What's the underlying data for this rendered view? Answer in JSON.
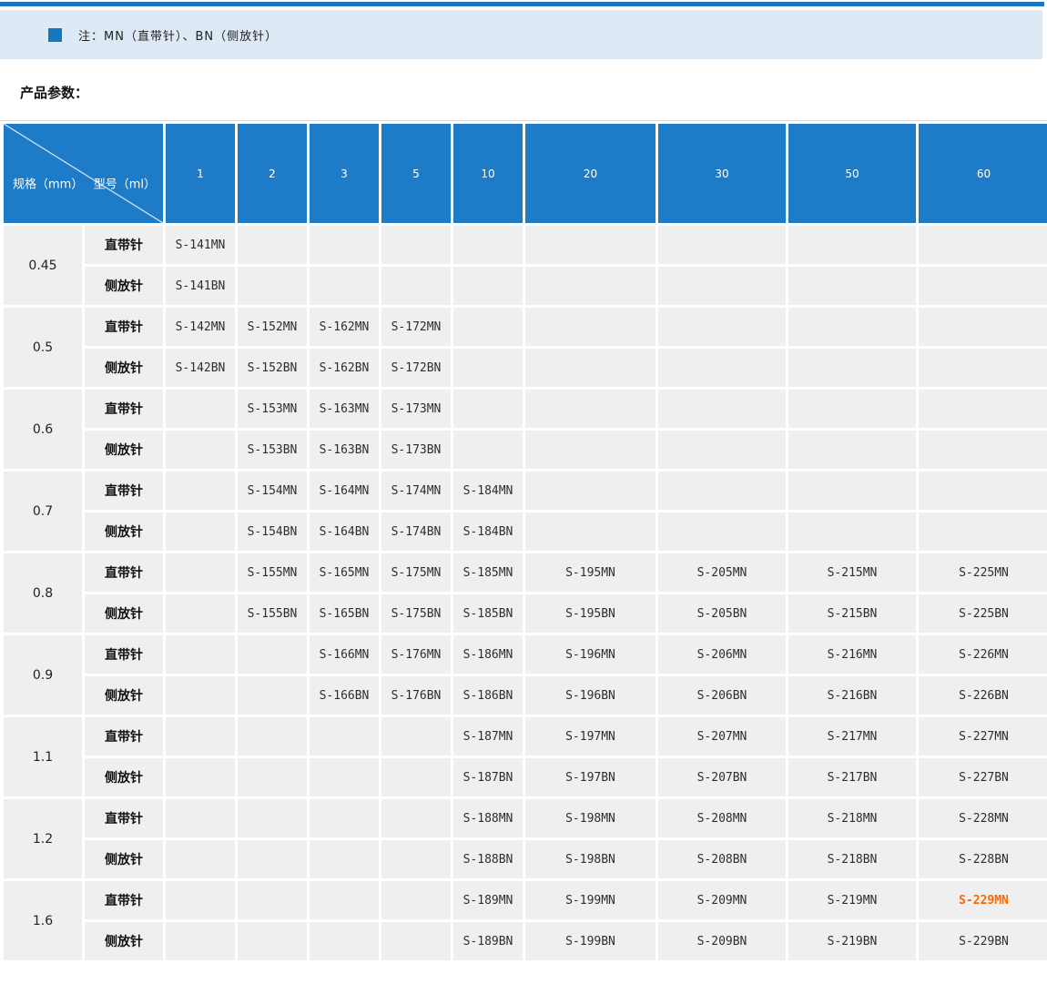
{
  "banner": {
    "note": "注：MN（直带针）、BN（侧放针）"
  },
  "section_title": "产品参数：",
  "colors": {
    "accent_blue": "#1e7bc8",
    "banner_bg": "#dde9f4",
    "cell_bg": "#efefef",
    "highlight_orange": "#ff6600"
  },
  "table": {
    "corner": {
      "row_label": "规格（mm）",
      "col_label": "型号（ml）"
    },
    "volumes": [
      "1",
      "2",
      "3",
      "5",
      "10",
      "20",
      "30",
      "50",
      "60"
    ],
    "highlight_value": "S-229MN",
    "groups": [
      {
        "spec": "0.45",
        "rows": [
          {
            "label": "直带针",
            "values": [
              "S-141MN",
              "",
              "",
              "",
              "",
              "",
              "",
              "",
              ""
            ]
          },
          {
            "label": "侧放针",
            "values": [
              "S-141BN",
              "",
              "",
              "",
              "",
              "",
              "",
              "",
              ""
            ]
          }
        ]
      },
      {
        "spec": "0.5",
        "rows": [
          {
            "label": "直带针",
            "values": [
              "S-142MN",
              "S-152MN",
              "S-162MN",
              "S-172MN",
              "",
              "",
              "",
              "",
              ""
            ]
          },
          {
            "label": "侧放针",
            "values": [
              "S-142BN",
              "S-152BN",
              "S-162BN",
              "S-172BN",
              "",
              "",
              "",
              "",
              ""
            ]
          }
        ]
      },
      {
        "spec": "0.6",
        "rows": [
          {
            "label": "直带针",
            "values": [
              "",
              "S-153MN",
              "S-163MN",
              "S-173MN",
              "",
              "",
              "",
              "",
              ""
            ]
          },
          {
            "label": "侧放针",
            "values": [
              "",
              "S-153BN",
              "S-163BN",
              "S-173BN",
              "",
              "",
              "",
              "",
              ""
            ]
          }
        ]
      },
      {
        "spec": "0.7",
        "rows": [
          {
            "label": "直带针",
            "values": [
              "",
              "S-154MN",
              "S-164MN",
              "S-174MN",
              "S-184MN",
              "",
              "",
              "",
              ""
            ]
          },
          {
            "label": "侧放针",
            "values": [
              "",
              "S-154BN",
              "S-164BN",
              "S-174BN",
              "S-184BN",
              "",
              "",
              "",
              ""
            ]
          }
        ]
      },
      {
        "spec": "0.8",
        "rows": [
          {
            "label": "直带针",
            "values": [
              "",
              "S-155MN",
              "S-165MN",
              "S-175MN",
              "S-185MN",
              "S-195MN",
              "S-205MN",
              "S-215MN",
              "S-225MN"
            ]
          },
          {
            "label": "侧放针",
            "values": [
              "",
              "S-155BN",
              "S-165BN",
              "S-175BN",
              "S-185BN",
              "S-195BN",
              "S-205BN",
              "S-215BN",
              "S-225BN"
            ]
          }
        ]
      },
      {
        "spec": "0.9",
        "rows": [
          {
            "label": "直带针",
            "values": [
              "",
              "",
              "S-166MN",
              "S-176MN",
              "S-186MN",
              "S-196MN",
              "S-206MN",
              "S-216MN",
              "S-226MN"
            ]
          },
          {
            "label": "侧放针",
            "values": [
              "",
              "",
              "S-166BN",
              "S-176BN",
              "S-186BN",
              "S-196BN",
              "S-206BN",
              "S-216BN",
              "S-226BN"
            ]
          }
        ]
      },
      {
        "spec": "1.1",
        "rows": [
          {
            "label": "直带针",
            "values": [
              "",
              "",
              "",
              "",
              "S-187MN",
              "S-197MN",
              "S-207MN",
              "S-217MN",
              "S-227MN"
            ]
          },
          {
            "label": "侧放针",
            "values": [
              "",
              "",
              "",
              "",
              "S-187BN",
              "S-197BN",
              "S-207BN",
              "S-217BN",
              "S-227BN"
            ]
          }
        ]
      },
      {
        "spec": "1.2",
        "rows": [
          {
            "label": "直带针",
            "values": [
              "",
              "",
              "",
              "",
              "S-188MN",
              "S-198MN",
              "S-208MN",
              "S-218MN",
              "S-228MN"
            ]
          },
          {
            "label": "侧放针",
            "values": [
              "",
              "",
              "",
              "",
              "S-188BN",
              "S-198BN",
              "S-208BN",
              "S-218BN",
              "S-228BN"
            ]
          }
        ]
      },
      {
        "spec": "1.6",
        "rows": [
          {
            "label": "直带针",
            "values": [
              "",
              "",
              "",
              "",
              "S-189MN",
              "S-199MN",
              "S-209MN",
              "S-219MN",
              "S-229MN"
            ]
          },
          {
            "label": "侧放针",
            "values": [
              "",
              "",
              "",
              "",
              "S-189BN",
              "S-199BN",
              "S-209BN",
              "S-219BN",
              "S-229BN"
            ]
          }
        ]
      }
    ]
  }
}
